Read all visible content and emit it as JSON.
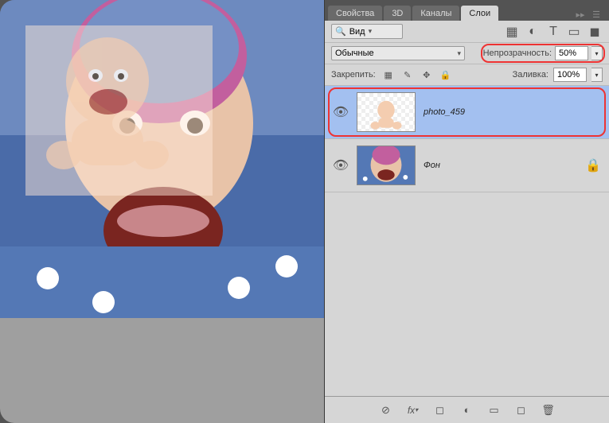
{
  "tabs": {
    "properties": "Свойства",
    "threed": "3D",
    "channels": "Каналы",
    "layers": "Слои",
    "active": "layers"
  },
  "filter": {
    "label": "Вид"
  },
  "blend": {
    "mode": "Обычные",
    "opacity_label": "Непрозрачность:",
    "opacity": "50%"
  },
  "lock": {
    "label": "Закрепить:",
    "fill_label": "Заливка:",
    "fill": "100%"
  },
  "layers_list": [
    {
      "name": "photo_459",
      "visible": true,
      "selected": true,
      "thumb": "cutout",
      "locked": false
    },
    {
      "name": "Фон",
      "visible": true,
      "selected": false,
      "thumb": "bg",
      "locked": true
    }
  ],
  "bottom_icons": [
    "link",
    "fx",
    "mask",
    "adjust",
    "group",
    "new",
    "trash"
  ]
}
